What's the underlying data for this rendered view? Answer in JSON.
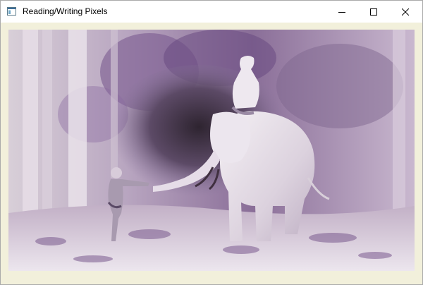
{
  "window": {
    "title": "Reading/Writing Pixels",
    "app_icon": "window-app-icon",
    "controls": {
      "minimize_icon": "minimize-icon",
      "maximize_icon": "maximize-icon",
      "close_icon": "close-icon"
    }
  },
  "content": {
    "image_description_icon": "inverted-photo-elephant-children",
    "background_color": "#f2f0db"
  }
}
